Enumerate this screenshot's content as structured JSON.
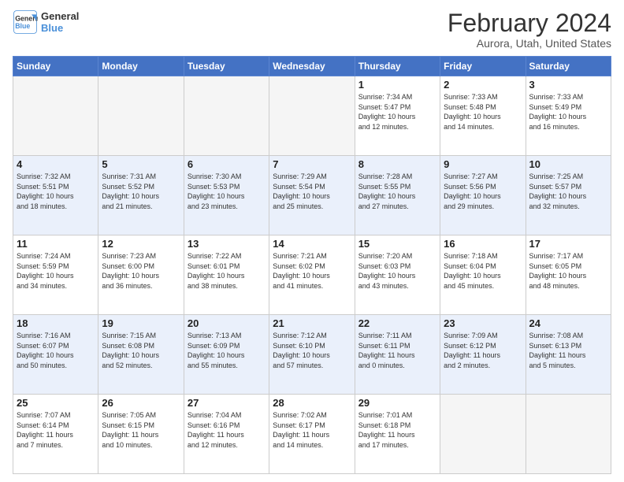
{
  "logo": {
    "line1": "General",
    "line2": "Blue"
  },
  "title": "February 2024",
  "subtitle": "Aurora, Utah, United States",
  "headers": [
    "Sunday",
    "Monday",
    "Tuesday",
    "Wednesday",
    "Thursday",
    "Friday",
    "Saturday"
  ],
  "weeks": [
    {
      "days": [
        {
          "num": "",
          "info": "",
          "empty": true
        },
        {
          "num": "",
          "info": "",
          "empty": true
        },
        {
          "num": "",
          "info": "",
          "empty": true
        },
        {
          "num": "",
          "info": "",
          "empty": true
        },
        {
          "num": "1",
          "info": "Sunrise: 7:34 AM\nSunset: 5:47 PM\nDaylight: 10 hours\nand 12 minutes.",
          "empty": false
        },
        {
          "num": "2",
          "info": "Sunrise: 7:33 AM\nSunset: 5:48 PM\nDaylight: 10 hours\nand 14 minutes.",
          "empty": false
        },
        {
          "num": "3",
          "info": "Sunrise: 7:33 AM\nSunset: 5:49 PM\nDaylight: 10 hours\nand 16 minutes.",
          "empty": false
        }
      ]
    },
    {
      "days": [
        {
          "num": "4",
          "info": "Sunrise: 7:32 AM\nSunset: 5:51 PM\nDaylight: 10 hours\nand 18 minutes.",
          "empty": false
        },
        {
          "num": "5",
          "info": "Sunrise: 7:31 AM\nSunset: 5:52 PM\nDaylight: 10 hours\nand 21 minutes.",
          "empty": false
        },
        {
          "num": "6",
          "info": "Sunrise: 7:30 AM\nSunset: 5:53 PM\nDaylight: 10 hours\nand 23 minutes.",
          "empty": false
        },
        {
          "num": "7",
          "info": "Sunrise: 7:29 AM\nSunset: 5:54 PM\nDaylight: 10 hours\nand 25 minutes.",
          "empty": false
        },
        {
          "num": "8",
          "info": "Sunrise: 7:28 AM\nSunset: 5:55 PM\nDaylight: 10 hours\nand 27 minutes.",
          "empty": false
        },
        {
          "num": "9",
          "info": "Sunrise: 7:27 AM\nSunset: 5:56 PM\nDaylight: 10 hours\nand 29 minutes.",
          "empty": false
        },
        {
          "num": "10",
          "info": "Sunrise: 7:25 AM\nSunset: 5:57 PM\nDaylight: 10 hours\nand 32 minutes.",
          "empty": false
        }
      ]
    },
    {
      "days": [
        {
          "num": "11",
          "info": "Sunrise: 7:24 AM\nSunset: 5:59 PM\nDaylight: 10 hours\nand 34 minutes.",
          "empty": false
        },
        {
          "num": "12",
          "info": "Sunrise: 7:23 AM\nSunset: 6:00 PM\nDaylight: 10 hours\nand 36 minutes.",
          "empty": false
        },
        {
          "num": "13",
          "info": "Sunrise: 7:22 AM\nSunset: 6:01 PM\nDaylight: 10 hours\nand 38 minutes.",
          "empty": false
        },
        {
          "num": "14",
          "info": "Sunrise: 7:21 AM\nSunset: 6:02 PM\nDaylight: 10 hours\nand 41 minutes.",
          "empty": false
        },
        {
          "num": "15",
          "info": "Sunrise: 7:20 AM\nSunset: 6:03 PM\nDaylight: 10 hours\nand 43 minutes.",
          "empty": false
        },
        {
          "num": "16",
          "info": "Sunrise: 7:18 AM\nSunset: 6:04 PM\nDaylight: 10 hours\nand 45 minutes.",
          "empty": false
        },
        {
          "num": "17",
          "info": "Sunrise: 7:17 AM\nSunset: 6:05 PM\nDaylight: 10 hours\nand 48 minutes.",
          "empty": false
        }
      ]
    },
    {
      "days": [
        {
          "num": "18",
          "info": "Sunrise: 7:16 AM\nSunset: 6:07 PM\nDaylight: 10 hours\nand 50 minutes.",
          "empty": false
        },
        {
          "num": "19",
          "info": "Sunrise: 7:15 AM\nSunset: 6:08 PM\nDaylight: 10 hours\nand 52 minutes.",
          "empty": false
        },
        {
          "num": "20",
          "info": "Sunrise: 7:13 AM\nSunset: 6:09 PM\nDaylight: 10 hours\nand 55 minutes.",
          "empty": false
        },
        {
          "num": "21",
          "info": "Sunrise: 7:12 AM\nSunset: 6:10 PM\nDaylight: 10 hours\nand 57 minutes.",
          "empty": false
        },
        {
          "num": "22",
          "info": "Sunrise: 7:11 AM\nSunset: 6:11 PM\nDaylight: 11 hours\nand 0 minutes.",
          "empty": false
        },
        {
          "num": "23",
          "info": "Sunrise: 7:09 AM\nSunset: 6:12 PM\nDaylight: 11 hours\nand 2 minutes.",
          "empty": false
        },
        {
          "num": "24",
          "info": "Sunrise: 7:08 AM\nSunset: 6:13 PM\nDaylight: 11 hours\nand 5 minutes.",
          "empty": false
        }
      ]
    },
    {
      "days": [
        {
          "num": "25",
          "info": "Sunrise: 7:07 AM\nSunset: 6:14 PM\nDaylight: 11 hours\nand 7 minutes.",
          "empty": false
        },
        {
          "num": "26",
          "info": "Sunrise: 7:05 AM\nSunset: 6:15 PM\nDaylight: 11 hours\nand 10 minutes.",
          "empty": false
        },
        {
          "num": "27",
          "info": "Sunrise: 7:04 AM\nSunset: 6:16 PM\nDaylight: 11 hours\nand 12 minutes.",
          "empty": false
        },
        {
          "num": "28",
          "info": "Sunrise: 7:02 AM\nSunset: 6:17 PM\nDaylight: 11 hours\nand 14 minutes.",
          "empty": false
        },
        {
          "num": "29",
          "info": "Sunrise: 7:01 AM\nSunset: 6:18 PM\nDaylight: 11 hours\nand 17 minutes.",
          "empty": false
        },
        {
          "num": "",
          "info": "",
          "empty": true
        },
        {
          "num": "",
          "info": "",
          "empty": true
        }
      ]
    }
  ]
}
